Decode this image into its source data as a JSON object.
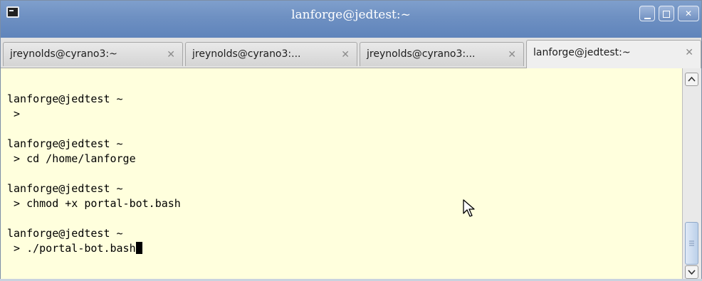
{
  "window": {
    "title": "lanforge@jedtest:~"
  },
  "title_buttons": {
    "minimize": "minimize-icon",
    "maximize": "maximize-icon",
    "close": "close-icon"
  },
  "tabs": [
    {
      "label": "jreynolds@cyrano3:~",
      "active": false
    },
    {
      "label": "jreynolds@cyrano3:...",
      "active": false
    },
    {
      "label": "jreynolds@cyrano3:...",
      "active": false
    },
    {
      "label": "lanforge@jedtest:~",
      "active": true
    }
  ],
  "terminal": {
    "lines": [
      "lanforge@jedtest ~",
      " >",
      "",
      "lanforge@jedtest ~",
      " > cd /home/lanforge",
      "",
      "lanforge@jedtest ~",
      " > chmod +x portal-bot.bash",
      "",
      "lanforge@jedtest ~",
      " > ./portal-bot.bash"
    ]
  },
  "colors": {
    "terminal_bg": "#ffffdd",
    "titlebar": "#6e90c2"
  }
}
